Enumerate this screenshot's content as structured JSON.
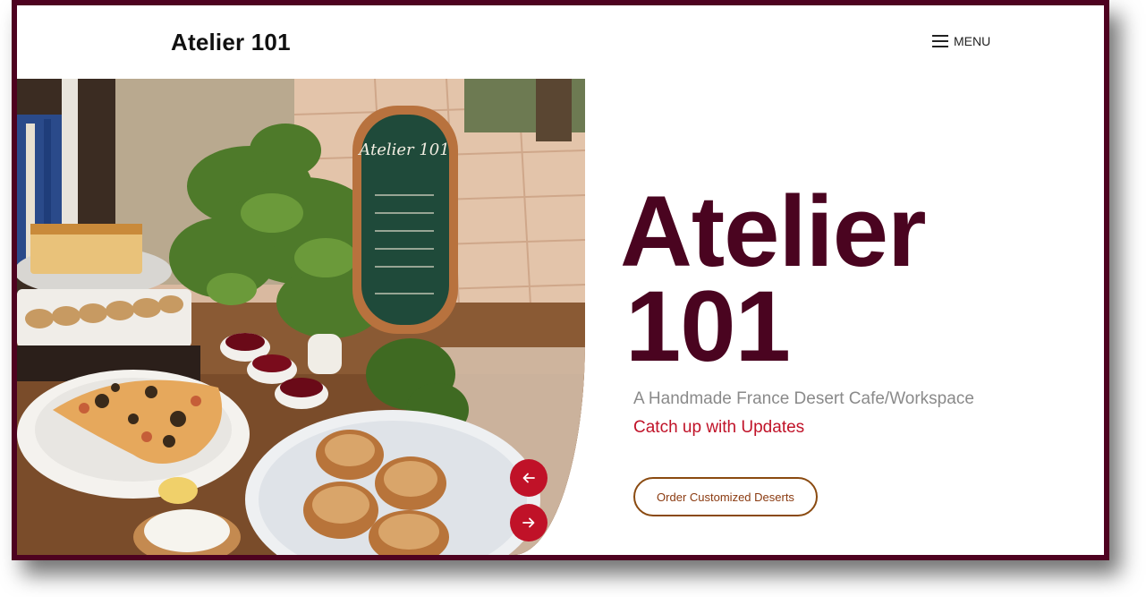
{
  "header": {
    "brand": "Atelier 101",
    "menu_label": "MENU"
  },
  "hero": {
    "title_line1": "Atelier",
    "title_line2": "101",
    "subtitle": "A Handmade France Desert Cafe/Workspace",
    "updates_link": "Catch up with Updates",
    "cta_label": "Order Customized Deserts",
    "image_icon": "cafe-photo",
    "signboard_text": "Atelier 101"
  },
  "slider": {
    "prev_icon": "arrow-left-icon",
    "next_icon": "arrow-right-icon"
  },
  "colors": {
    "frame": "#4e0220",
    "title": "#4a0420",
    "accent": "#c01228",
    "cta_border": "#8a4a10",
    "subtitle": "#8a8a8a"
  }
}
